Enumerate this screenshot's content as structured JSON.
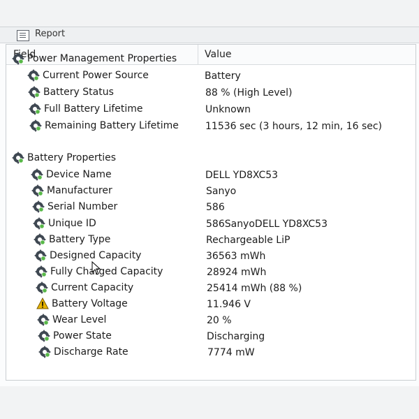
{
  "window": {
    "tab_label": "Report"
  },
  "table": {
    "col_field": "Field",
    "col_value": "Value"
  },
  "rows": [
    {
      "field": "Power Management Properties",
      "value": "",
      "icon": "gear-icon",
      "level": 0
    },
    {
      "field": "Current Power Source",
      "value": "Battery",
      "icon": "gear-icon",
      "level": 1
    },
    {
      "field": "Battery Status",
      "value": "88 % (High Level)",
      "icon": "gear-icon",
      "level": 1
    },
    {
      "field": "Full Battery Lifetime",
      "value": "Unknown",
      "icon": "gear-icon",
      "level": 1
    },
    {
      "field": "Remaining Battery Lifetime",
      "value": "11536 sec (3 hours, 12 min, 16 sec)",
      "icon": "gear-icon",
      "level": 1
    },
    {
      "field": "Battery Properties",
      "value": "",
      "icon": "gear-icon",
      "level": 0
    },
    {
      "field": "Device Name",
      "value": "DELL YD8XC53",
      "icon": "gear-icon",
      "level": 1
    },
    {
      "field": "Manufacturer",
      "value": "Sanyo",
      "icon": "gear-icon",
      "level": 1
    },
    {
      "field": "Serial Number",
      "value": "586",
      "icon": "gear-icon",
      "level": 1
    },
    {
      "field": "Unique ID",
      "value": "586SanyoDELL YD8XC53",
      "icon": "gear-icon",
      "level": 1
    },
    {
      "field": "Battery Type",
      "value": "Rechargeable LiP",
      "icon": "gear-icon",
      "level": 1
    },
    {
      "field": "Designed Capacity",
      "value": "36563 mWh",
      "icon": "gear-icon",
      "level": 1
    },
    {
      "field": "Fully Charged Capacity",
      "value": "28924 mWh",
      "icon": "gear-icon",
      "level": 1
    },
    {
      "field": "Current Capacity",
      "value": "25414 mWh  (88 %)",
      "icon": "gear-icon",
      "level": 1
    },
    {
      "field": "Battery Voltage",
      "value": "11.946 V",
      "icon": "warning-icon",
      "level": 1
    },
    {
      "field": "Wear Level",
      "value": "20 %",
      "icon": "gear-icon",
      "level": 1
    },
    {
      "field": "Power State",
      "value": "Discharging",
      "icon": "gear-icon",
      "level": 1
    },
    {
      "field": "Discharge Rate",
      "value": "7774 mW",
      "icon": "gear-icon",
      "level": 1
    }
  ],
  "colors": {
    "gear": "#3f4852",
    "gear_accent": "#58b848",
    "warning": "#e8b500"
  }
}
